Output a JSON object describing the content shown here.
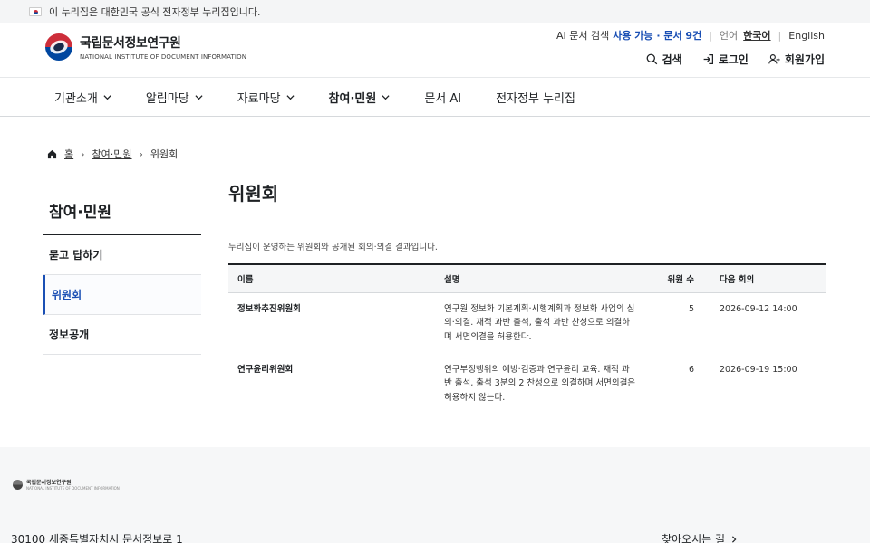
{
  "gov_banner": {
    "text": "이 누리집은 대한민국 공식 전자정부 누리집입니다."
  },
  "logo": {
    "name_ko": "국립문서정보연구원",
    "name_en": "NATIONAL INSTITUTE OF DOCUMENT INFORMATION"
  },
  "util": {
    "ai_label": "AI 문서 검색",
    "ai_status": "사용 가능 · 문서 9건",
    "lang_label": "언어",
    "lang_selected": "한국어",
    "lang_other": "English"
  },
  "actions": {
    "search": "검색",
    "login": "로그인",
    "signup": "회원가입"
  },
  "nav": {
    "items": [
      {
        "label": "기관소개"
      },
      {
        "label": "알림마당"
      },
      {
        "label": "자료마당"
      },
      {
        "label": "참여·민원"
      },
      {
        "label": "문서 AI"
      },
      {
        "label": "전자정부 누리집"
      }
    ]
  },
  "breadcrumb": {
    "home": "홈",
    "section": "참여·민원",
    "current": "위원회"
  },
  "side": {
    "title": "참여·민원",
    "items": [
      {
        "label": "묻고 답하기"
      },
      {
        "label": "위원회"
      },
      {
        "label": "정보공개"
      }
    ]
  },
  "main": {
    "title": "위원회",
    "description": "누리집이 운영하는 위원회와 공개된 회의·의결 결과입니다.",
    "headers": {
      "name": "이름",
      "desc": "설명",
      "members": "위원 수",
      "next": "다음 회의"
    },
    "rows": [
      {
        "name": "정보화추진위원회",
        "desc": "연구원 정보화 기본계획·시행계획과 정보화 사업의 심의·의결. 재적 과반 출석, 출석 과반 찬성으로 의결하며 서면의결을 허용한다.",
        "members": "5",
        "next": "2026-09-12 14:00"
      },
      {
        "name": "연구윤리위원회",
        "desc": "연구부정행위의 예방·검증과 연구윤리 교육. 재적 과반 출석, 출석 3분의 2 찬성으로 의결하며 서면의결은 허용하지 않는다.",
        "members": "6",
        "next": "2026-09-19 15:00"
      }
    ]
  },
  "footer": {
    "logo_ko": "국립문서정보연구원",
    "logo_en": "NATIONAL INSTITUTE OF DOCUMENT INFORMATION",
    "address": "30100 세종특별자치시 문서정보로 1",
    "directions": "찾아오시는 길"
  },
  "colors": {
    "accent": "#1a4fb4",
    "text": "#1e2124",
    "footer_bg": "#f6f7f8"
  }
}
